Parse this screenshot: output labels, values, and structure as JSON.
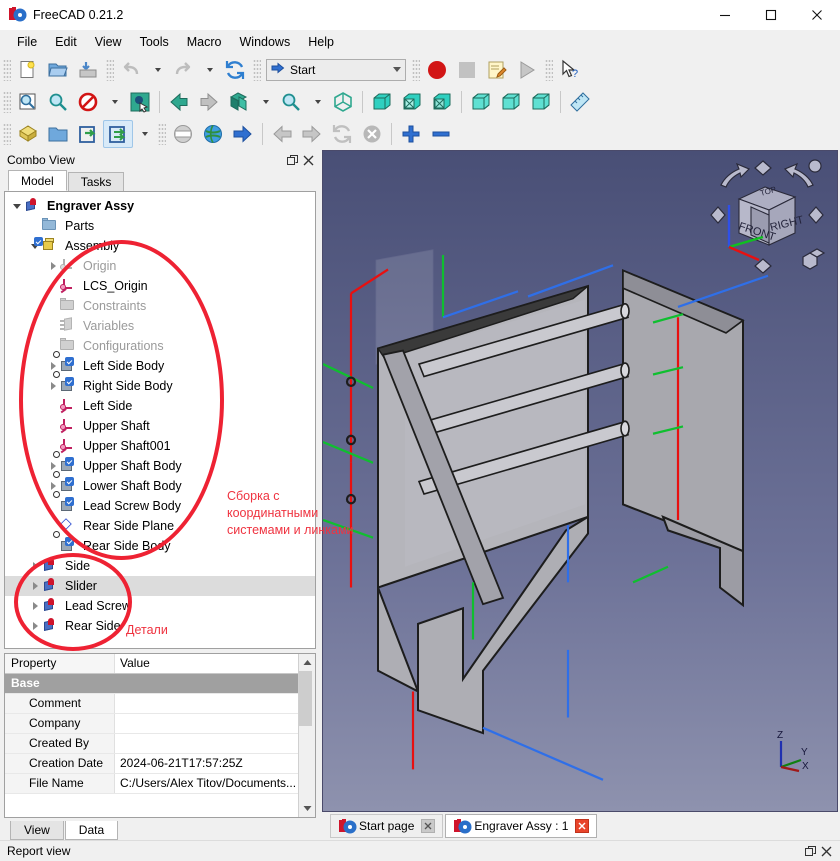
{
  "window": {
    "title": "FreeCAD 0.21.2",
    "icon": "freecad-logo-icon",
    "minimize": "minimize-icon",
    "maximize": "maximize-icon",
    "close": "close-icon"
  },
  "menubar": {
    "items": [
      {
        "label": "File"
      },
      {
        "label": "Edit"
      },
      {
        "label": "View"
      },
      {
        "label": "Tools"
      },
      {
        "label": "Macro"
      },
      {
        "label": "Windows"
      },
      {
        "label": "Help"
      }
    ]
  },
  "toolbars": {
    "file": [
      {
        "name": "new-document-button",
        "icon": "new-file-icon"
      },
      {
        "name": "open-document-button",
        "icon": "open-folder-icon"
      },
      {
        "name": "save-document-button",
        "icon": "save-icon"
      }
    ],
    "edit": [
      {
        "name": "undo-button",
        "icon": "undo-arrow-icon"
      },
      {
        "name": "undo-dropdown-button",
        "icon": "chevron-down-icon"
      },
      {
        "name": "redo-button",
        "icon": "redo-arrow-icon"
      },
      {
        "name": "redo-dropdown-button",
        "icon": "chevron-down-icon"
      },
      {
        "name": "refresh-button",
        "icon": "refresh-icon"
      }
    ],
    "workbench": {
      "name": "workbench-selector",
      "value": "Start",
      "icon": "blue-arrow-icon",
      "chevron": "chevron-down-icon"
    },
    "macro": [
      {
        "name": "macro-record-button",
        "icon": "record-circle-icon"
      },
      {
        "name": "macro-stop-button",
        "icon": "stop-square-icon"
      },
      {
        "name": "macro-edit-button",
        "icon": "macro-edit-icon"
      },
      {
        "name": "macro-execute-button",
        "icon": "play-triangle-icon"
      }
    ],
    "help": [
      {
        "name": "whats-this-button",
        "icon": "cursor-question-icon"
      }
    ],
    "view": [
      {
        "name": "fit-all-button",
        "icon": "fit-all-icon"
      },
      {
        "name": "fit-selection-button",
        "icon": "fit-selection-icon"
      },
      {
        "name": "draw-style-button",
        "icon": "no-entry-icon"
      },
      {
        "name": "draw-style-dropdown",
        "icon": "chevron-down-icon"
      },
      {
        "name": "select-box-button",
        "icon": "box-selection-icon"
      },
      {
        "name": "back-view-button",
        "icon": "left-arrow-icon"
      },
      {
        "name": "forward-view-button",
        "icon": "right-arrow-icon"
      },
      {
        "name": "std-views-button",
        "icon": "axonometric-box-icon"
      },
      {
        "name": "std-views-dropdown",
        "icon": "chevron-down-icon"
      },
      {
        "name": "zoom-button",
        "icon": "magnifier-icon"
      },
      {
        "name": "zoom-dropdown",
        "icon": "chevron-down-icon"
      },
      {
        "name": "isometric-view-button",
        "icon": "isometric-cube-icon"
      },
      {
        "name": "front-view-button",
        "icon": "front-cube-icon"
      },
      {
        "name": "top-view-button",
        "icon": "top-cube-icon"
      },
      {
        "name": "right-view-button",
        "icon": "right-cube-icon"
      },
      {
        "name": "rear-view-button",
        "icon": "rear-cube-icon"
      },
      {
        "name": "bottom-view-button",
        "icon": "bottom-cube-icon"
      },
      {
        "name": "left-view-button",
        "icon": "left-cube-icon"
      },
      {
        "name": "measure-button",
        "icon": "ruler-icon"
      }
    ],
    "structure": [
      {
        "name": "create-part-button",
        "icon": "yellow-part-icon"
      },
      {
        "name": "create-group-button",
        "icon": "folder-icon"
      },
      {
        "name": "make-link-button",
        "icon": "link-icon"
      },
      {
        "name": "make-sublink-button",
        "icon": "link-group-icon",
        "active": true
      },
      {
        "name": "link-dropdown-button",
        "icon": "chevron-down-icon"
      }
    ],
    "web": [
      {
        "name": "browser-home-button",
        "icon": "browser-icon"
      },
      {
        "name": "load-page-button",
        "icon": "globe-icon"
      },
      {
        "name": "go-button",
        "icon": "blue-right-arrow-icon"
      },
      {
        "name": "nav-back-button",
        "icon": "grey-left-arrow-icon"
      },
      {
        "name": "nav-forward-button",
        "icon": "grey-right-arrow-icon"
      },
      {
        "name": "nav-refresh-button",
        "icon": "grey-refresh-icon"
      },
      {
        "name": "nav-stop-button",
        "icon": "stop-x-icon"
      },
      {
        "name": "zoom-in-button",
        "icon": "plus-icon"
      },
      {
        "name": "zoom-out-button",
        "icon": "minus-icon"
      }
    ]
  },
  "combo_view": {
    "title": "Combo View",
    "float_button": "undock-icon",
    "close_button": "close-icon",
    "tabs": [
      {
        "label": "Model",
        "selected": true
      },
      {
        "label": "Tasks",
        "selected": false
      }
    ],
    "tree": [
      {
        "label": "Engraver Assy",
        "depth": 0,
        "icon": "document-icon",
        "expander": "expanded",
        "bold": true
      },
      {
        "label": "Parts",
        "depth": 1,
        "icon": "folder-icon",
        "expander": "none"
      },
      {
        "label": "Assembly",
        "depth": 1,
        "icon": "assembly-icon",
        "expander": "expanded"
      },
      {
        "label": "Origin",
        "depth": 2,
        "icon": "origin-icon",
        "expander": "collapsed",
        "dim": true
      },
      {
        "label": "LCS_Origin",
        "depth": 2,
        "icon": "lcs-icon",
        "expander": "none"
      },
      {
        "label": "Constraints",
        "depth": 2,
        "icon": "folder-icon",
        "expander": "none",
        "dim": true
      },
      {
        "label": "Variables",
        "depth": 2,
        "icon": "variables-icon",
        "expander": "none",
        "dim": true
      },
      {
        "label": "Configurations",
        "depth": 2,
        "icon": "folder-icon",
        "expander": "none",
        "dim": true
      },
      {
        "label": "Left Side Body",
        "depth": 2,
        "icon": "body-link-icon",
        "expander": "collapsed"
      },
      {
        "label": "Right Side Body",
        "depth": 2,
        "icon": "body-link-icon",
        "expander": "collapsed"
      },
      {
        "label": "Left Side",
        "depth": 2,
        "icon": "lcs-icon",
        "expander": "none"
      },
      {
        "label": "Upper Shaft",
        "depth": 2,
        "icon": "lcs-icon",
        "expander": "none"
      },
      {
        "label": "Upper Shaft001",
        "depth": 2,
        "icon": "lcs-icon",
        "expander": "none"
      },
      {
        "label": "Upper Shaft Body",
        "depth": 2,
        "icon": "body-link-icon",
        "expander": "collapsed"
      },
      {
        "label": "Lower Shaft Body",
        "depth": 2,
        "icon": "body-link-icon",
        "expander": "collapsed"
      },
      {
        "label": "Lead Screw Body",
        "depth": 2,
        "icon": "body-link-icon",
        "expander": "none"
      },
      {
        "label": "Rear Side Plane",
        "depth": 2,
        "icon": "plane-icon",
        "expander": "none"
      },
      {
        "label": "Rear Side Body",
        "depth": 2,
        "icon": "body-link-icon",
        "expander": "none"
      },
      {
        "label": "Side",
        "depth": 1,
        "icon": "document-icon",
        "expander": "collapsed"
      },
      {
        "label": "Slider",
        "depth": 1,
        "icon": "document-icon",
        "expander": "collapsed",
        "selected": true
      },
      {
        "label": "Lead Screw",
        "depth": 1,
        "icon": "document-icon",
        "expander": "collapsed"
      },
      {
        "label": "Rear Side",
        "depth": 1,
        "icon": "document-icon",
        "expander": "collapsed"
      }
    ]
  },
  "property_editor": {
    "headers": {
      "property": "Property",
      "value": "Value"
    },
    "group": "Base",
    "rows": [
      {
        "property": "Comment",
        "value": ""
      },
      {
        "property": "Company",
        "value": ""
      },
      {
        "property": "Created By",
        "value": ""
      },
      {
        "property": "Creation Date",
        "value": "2024-06-21T17:57:25Z"
      },
      {
        "property": "File Name",
        "value": "C:/Users/Alex Titov/Documents..."
      }
    ],
    "scroll_up": "scroll-up-icon",
    "scroll_down": "scroll-down-icon",
    "tabs": [
      {
        "label": "View",
        "selected": false
      },
      {
        "label": "Data",
        "selected": true
      }
    ]
  },
  "viewport": {
    "nav_cube": {
      "front": "FRONT",
      "right": "RIGHT",
      "top": "TOP",
      "arrow_up": "nav-arrow-up-icon",
      "arrow_down": "nav-arrow-down-icon",
      "arrow_left": "nav-arrow-left-icon",
      "arrow_right": "nav-arrow-right-icon",
      "rotate_left": "nav-rotate-left-icon",
      "rotate_right": "nav-rotate-right-icon",
      "home": "nav-home-icon",
      "corner": "nav-corner-icon"
    },
    "axis_indicator": {
      "x": "X",
      "y": "Y",
      "z": "Z"
    }
  },
  "document_tabs": [
    {
      "label": "Start page",
      "selected": false,
      "close": "close-icon"
    },
    {
      "label": "Engraver Assy : 1",
      "selected": true,
      "close": "close-icon"
    }
  ],
  "report_view": {
    "title": "Report view",
    "float_button": "undock-icon",
    "close_button": "close-icon"
  },
  "annotations": [
    {
      "text": "Сборка с\nкоординатными\nсистемами и линками",
      "color": "#ef3340"
    },
    {
      "text": "Детали",
      "color": "#ef3340"
    }
  ],
  "colors": {
    "annotation": "#ef3340",
    "ellipse": "#ee2233",
    "selection": "#dcdcdc",
    "group_header": "#a0a0a0",
    "viewport_top": "#494f76",
    "viewport_bottom": "#8e92ae"
  }
}
